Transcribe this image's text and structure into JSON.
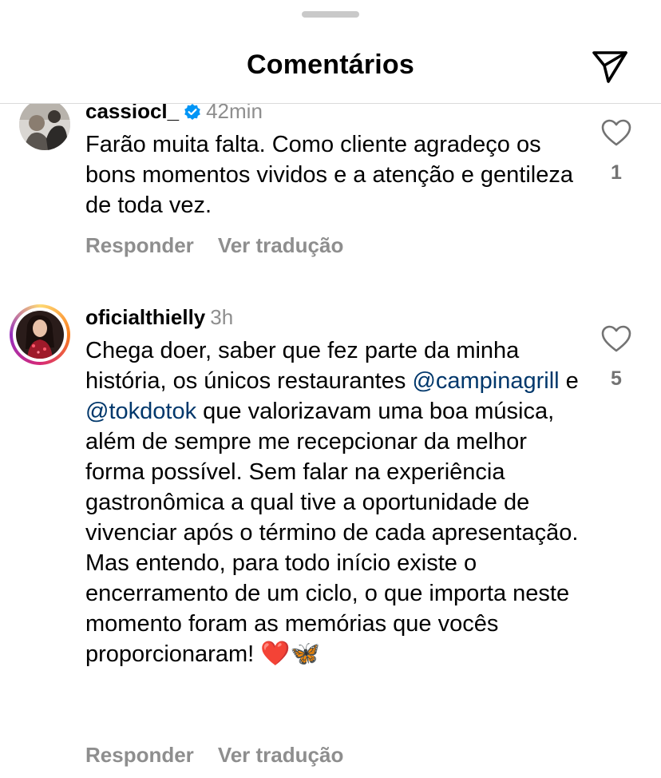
{
  "header": {
    "title": "Comentários",
    "share_icon": "paper-plane-icon"
  },
  "comments": [
    {
      "username": "cassiocl_",
      "verified": true,
      "time": "42min",
      "text": "Farão muita falta. Como cliente agradeço os bons momentos vividos e a atenção e gentileza de toda vez.",
      "reply_label": "Responder",
      "translate_label": "Ver tradução",
      "likes": "1"
    },
    {
      "username": "oficialthielly",
      "time": "3h",
      "text_before": "Chega doer, saber que fez parte da minha história, os únicos restaurantes ",
      "mention1": "@campinagrill",
      "text_mid": " e ",
      "mention2": "@tokdotok",
      "text_after": " que valorizavam uma boa música, além de sempre me recepcionar da melhor forma possível. Sem falar na experiência gastronômica a qual tive a oportunidade de vivenciar após o término de cada apresentação. Mas entendo, para todo início existe o encerramento de um ciclo, o que importa neste momento foram as memórias que vocês proporcionaram! ",
      "emoji_heart": "❤️",
      "emoji_butterfly": "🦋",
      "reply_label": "Responder",
      "translate_label": "Ver tradução",
      "likes": "5"
    }
  ],
  "colors": {
    "mention": "#00376b",
    "secondary_text": "#8e8e8e",
    "verified_badge": "#0095f6",
    "story_ring_start": "#feda75",
    "story_ring_end": "#d62976"
  }
}
